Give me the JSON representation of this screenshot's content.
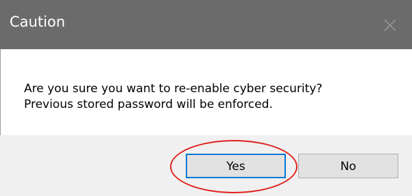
{
  "dialog": {
    "title": "Caution",
    "message_line1": "Are you sure you want to re-enable cyber security?",
    "message_line2": "Previous stored password will be enforced.",
    "yes_label": "Yes",
    "no_label": "No"
  },
  "colors": {
    "titlebar": "#6b6b6b",
    "focus_border": "#0078d7",
    "annotation_ring": "#e0201c"
  }
}
